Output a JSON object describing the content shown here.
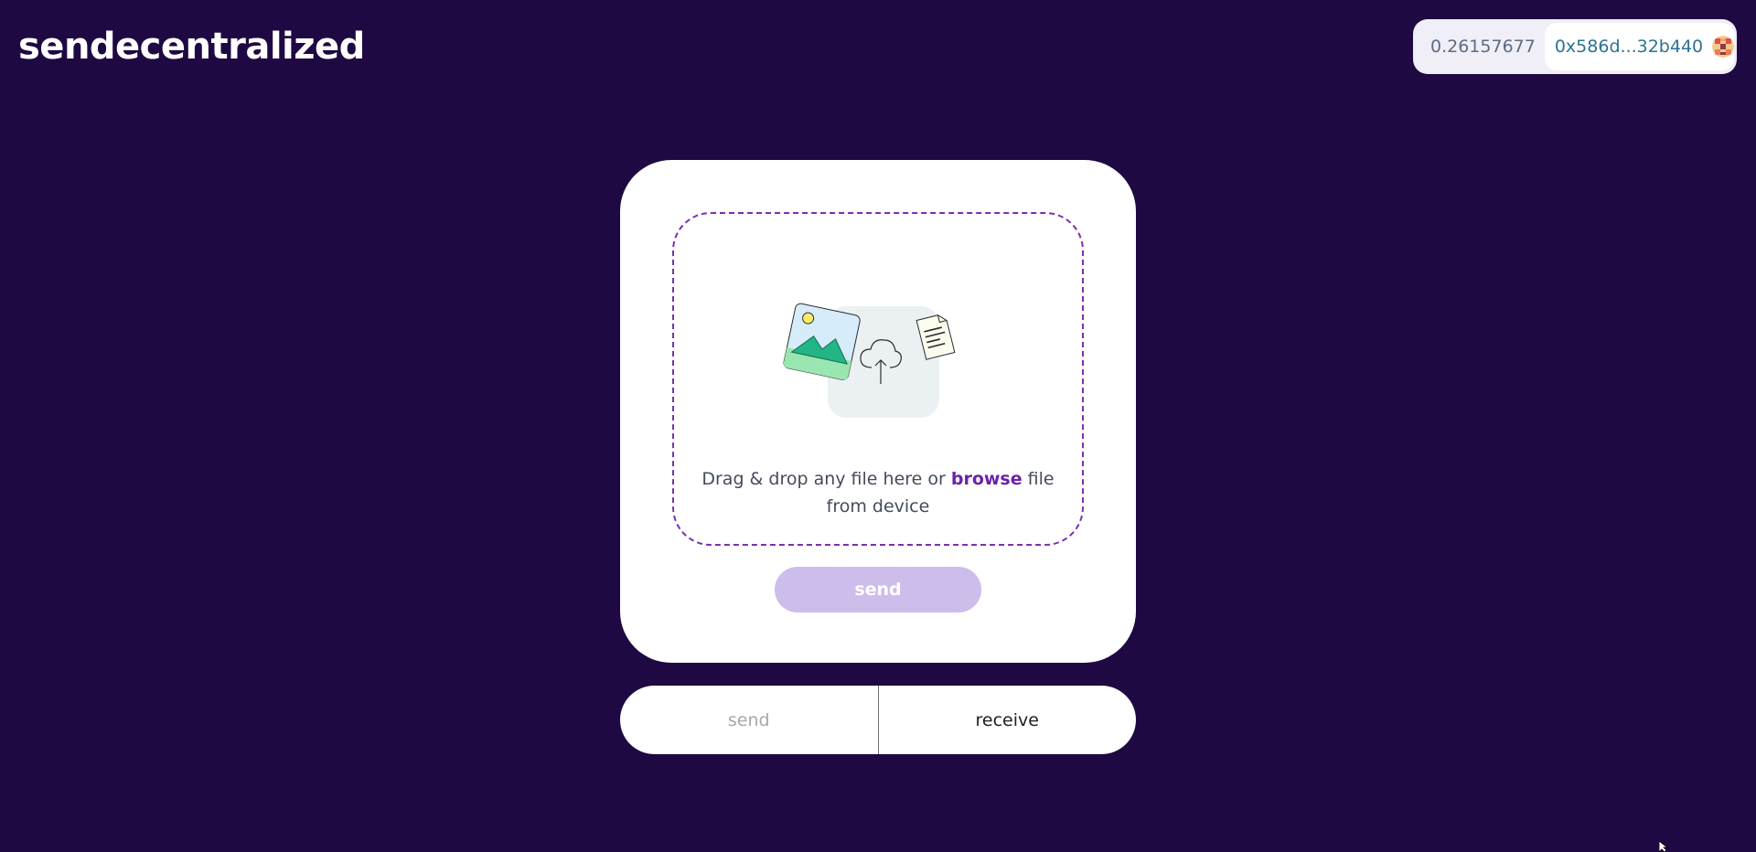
{
  "header": {
    "app_title": "sendecentralized"
  },
  "wallet": {
    "balance": "0.26157677",
    "address": "0x586d...32b440",
    "avatar_icon": "identicon-avatar-icon"
  },
  "upload": {
    "illustration_icon": "upload-files-illustration",
    "text_before": "Drag & drop any file here or ",
    "browse_label": "browse",
    "text_after": " file from device"
  },
  "card": {
    "send_label": "send"
  },
  "mode_toggle": {
    "send_label": "send",
    "receive_label": "receive"
  },
  "colors": {
    "background": "#1f0942",
    "accent": "#7b2fb0",
    "send_disabled": "#cdbdea",
    "address": "#2b7391"
  }
}
